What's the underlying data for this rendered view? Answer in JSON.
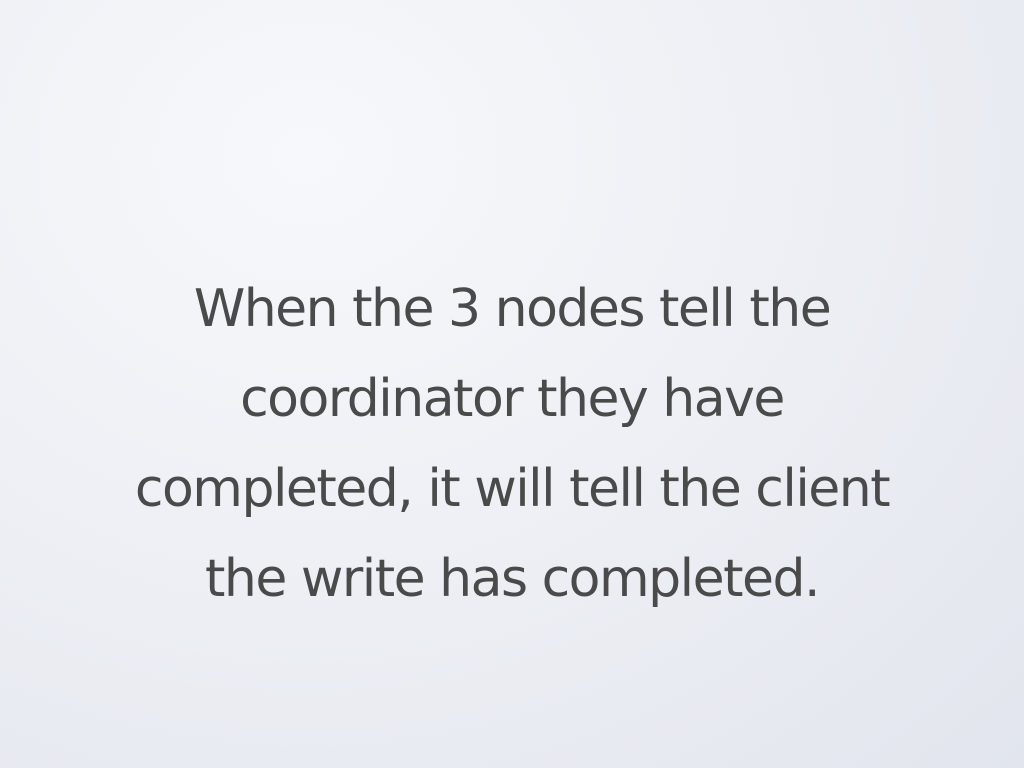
{
  "slide": {
    "lines": [
      "When the 3 nodes tell the",
      "coordinator they have",
      "completed, it will tell the client",
      "the write has completed."
    ]
  },
  "colors": {
    "text": "#4a4a4a",
    "background": "#eef0f5"
  }
}
